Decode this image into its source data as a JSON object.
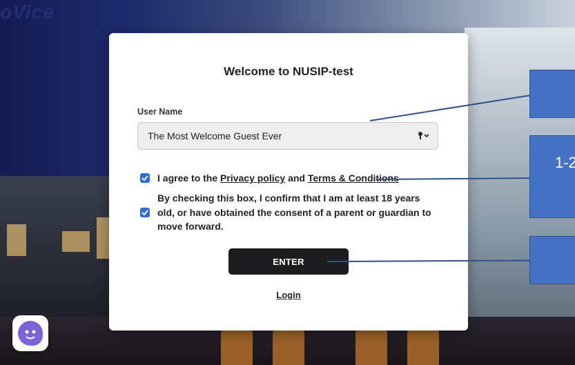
{
  "background": {
    "logo_text": "oVice"
  },
  "callouts": [
    {
      "label": ""
    },
    {
      "label": "1-2"
    },
    {
      "label": ""
    }
  ],
  "modal": {
    "title": "Welcome to NUSIP-test",
    "user_name_label": "User Name",
    "user_name_value": "The Most Welcome Guest Ever",
    "privacy": {
      "prefix": "I agree to the ",
      "privacy_link": "Privacy policy",
      "and": " and ",
      "terms_link": "Terms & Conditions",
      "checked": true
    },
    "age_consent": {
      "text": "By checking this box, I confirm that I am at least 18 years old, or have obtained the consent of a parent or guardian to move forward.",
      "checked": true
    },
    "enter_label": "ENTER",
    "login_label": "Login"
  },
  "colors": {
    "accent": "#2e6bd6",
    "button": "#1d1d1f",
    "callout": "#4472c4"
  },
  "icons": {
    "input_right": "key-dropdown-icon",
    "chat": "chat-assistant-icon"
  }
}
